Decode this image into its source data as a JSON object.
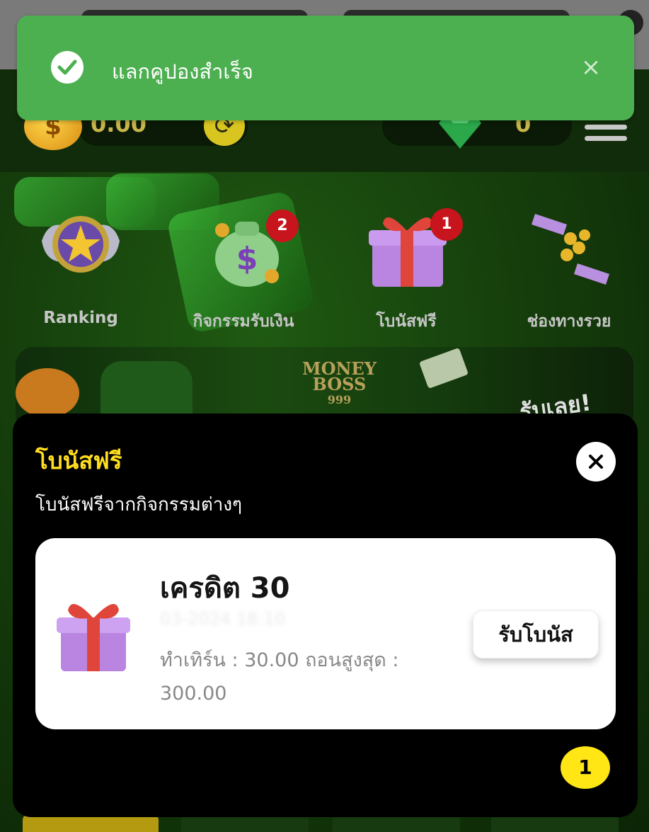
{
  "toast": {
    "message": "แลกคูปองสำเร็จ",
    "type": "success",
    "color": "#4caf50"
  },
  "header": {
    "balance": "0.00",
    "gems": "0"
  },
  "shortcuts": [
    {
      "label": "Ranking",
      "badge": ""
    },
    {
      "label": "กิจกรรมรับเงิน",
      "badge": "2"
    },
    {
      "label": "โบนัสฟรี",
      "badge": "1"
    },
    {
      "label": "ช่องทางรวย",
      "badge": ""
    }
  ],
  "banner": {
    "logo_line1": "MONEY",
    "logo_line2": "BOSS",
    "logo_line3": "999",
    "cta": "รับเลย!"
  },
  "sheet": {
    "title": "โบนัสฟรี",
    "subtitle": "โบนัสฟรีจากกิจกรรมต่างๆ",
    "title_color": "#ffde1f",
    "items": [
      {
        "title": "เครดิต 30",
        "date": "03-2024 18:10",
        "turnover": "ทำเทิร์น : 30.00  ถอนสูงสุด :",
        "max_withdraw": "300.00",
        "claim_label": "รับโบนัส"
      }
    ],
    "page": "1",
    "page_badge_color": "#ffe614"
  }
}
